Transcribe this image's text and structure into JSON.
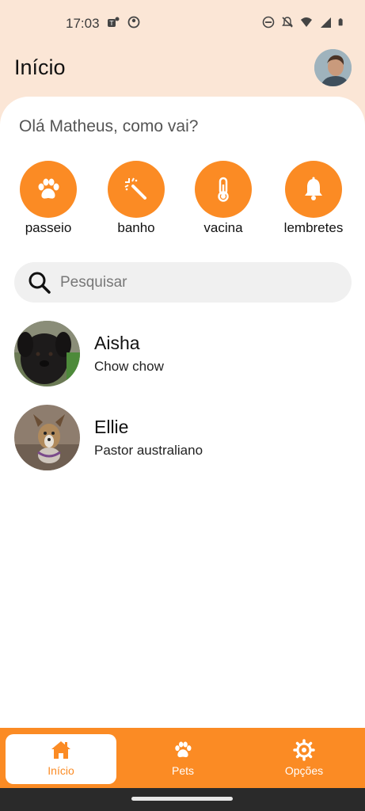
{
  "status_bar": {
    "time": "17:03",
    "left_icons": [
      "teams-icon",
      "app-icon"
    ],
    "right_icons": [
      "dnd-icon",
      "mute-icon",
      "wifi-icon",
      "signal-icon",
      "battery-icon"
    ]
  },
  "header": {
    "title": "Início",
    "avatar_icon": "user-avatar"
  },
  "greeting": "Olá Matheus, como vai?",
  "quick_actions": [
    {
      "label": "passeio",
      "icon": "paw-icon"
    },
    {
      "label": "banho",
      "icon": "magic-wand-icon"
    },
    {
      "label": "vacina",
      "icon": "thermometer-icon"
    },
    {
      "label": "lembretes",
      "icon": "bell-icon"
    }
  ],
  "search": {
    "placeholder": "Pesquisar",
    "value": ""
  },
  "pets": [
    {
      "name": "Aisha",
      "breed": "Chow chow"
    },
    {
      "name": "Ellie",
      "breed": "Pastor australiano"
    }
  ],
  "bottom_nav": [
    {
      "label": "Início",
      "icon": "home-icon",
      "active": true
    },
    {
      "label": "Pets",
      "icon": "paw-icon",
      "active": false
    },
    {
      "label": "Opções",
      "icon": "gear-icon",
      "active": false
    }
  ],
  "colors": {
    "accent": "#fb8b24",
    "header_bg": "#fbe6d6",
    "card_bg": "#ffffff",
    "search_bg": "#f0f0f0"
  }
}
